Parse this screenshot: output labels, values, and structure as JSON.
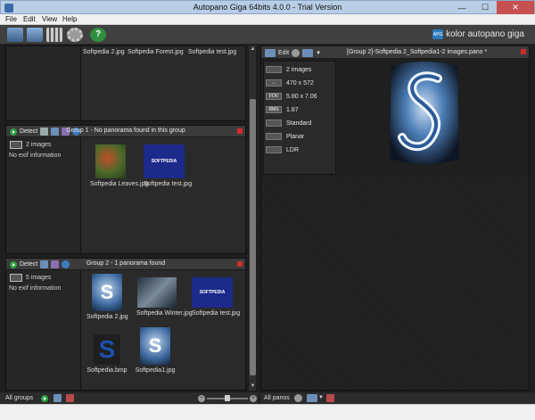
{
  "window": {
    "title": "Autopano Giga 64bits 4.0.0 - Trial Version",
    "minimize": "—",
    "maximize": "☐",
    "close": "✕"
  },
  "menu": [
    "File",
    "Edit",
    "View",
    "Help"
  ],
  "toolbar": {
    "icons": [
      "import-images-icon",
      "import-folder-icon",
      "group-grid-icon",
      "settings-gear-icon",
      "help-icon"
    ],
    "logo_badge": "APG",
    "logo_text": "kolor autopano giga"
  },
  "left_groups": {
    "top_group": {
      "images": [
        "Softpedia 2.jpg",
        "Softpedia Forest.jpg",
        "Softpedia test.jpg"
      ]
    },
    "group1": {
      "detect_label": "Detect",
      "title": "Group 1 - No panorama found in this group",
      "image_count": "2 images",
      "exif": "No exif information",
      "images": [
        "Softpedia Leaves.jpg",
        "Softpedia test.jpg"
      ]
    },
    "group2": {
      "detect_label": "Detect",
      "title": "Group 2 - 1 panorama found",
      "image_count": "5 images",
      "exif": "No exif information",
      "images": [
        "Softpedia 2.jpg",
        "Softpedia Winter.jpg",
        "Softpedia test.jpg",
        "Softpedia.bmp",
        "Softpedia1.jpg"
      ]
    },
    "thumb_text_banner": "SOFTPEDIA"
  },
  "left_footer": {
    "label": "All groups"
  },
  "right_panel": {
    "edit_label": "Edit",
    "title": "[Group 2]-Softpedia 2_Softpedia1-2 images.pano *",
    "info": [
      {
        "icon": "images-icon",
        "value": "2 images"
      },
      {
        "icon": "size-icon",
        "value": "470 x 572"
      },
      {
        "icon": "fov-icon",
        "icon_text": "FOV",
        "value": "5.80 x 7.06"
      },
      {
        "icon": "rms-icon",
        "icon_text": "RMS",
        "value": "1.87"
      },
      {
        "icon": "blend-icon",
        "value": "Standard"
      },
      {
        "icon": "projection-icon",
        "value": "Planar"
      },
      {
        "icon": "dynamic-range-icon",
        "value": "LDR"
      }
    ]
  },
  "right_footer": {
    "label": "All panos"
  },
  "colors": {
    "accent": "#2b7ac0",
    "detect_green": "#2ea043",
    "close_red": "#d02c2c"
  }
}
